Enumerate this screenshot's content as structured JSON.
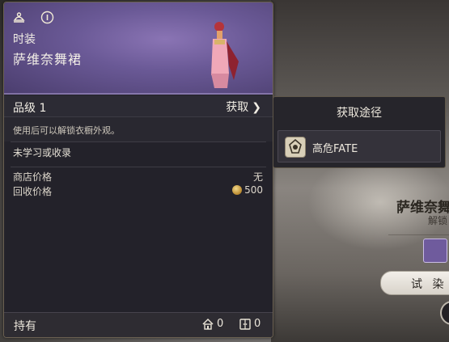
{
  "item": {
    "type": "时装",
    "name": "萨维奈舞裙",
    "grade_label": "品级 1",
    "obtain_label": "获取",
    "description": "使用后可以解锁衣橱外观。",
    "learn_status": "未学习或收录",
    "shop_price_label": "商店价格",
    "shop_price_value": "无",
    "sell_price_label": "回收价格",
    "sell_price_value": "500",
    "hold_label": "持有",
    "house_count": "0",
    "armoire_count": "0"
  },
  "acquisition": {
    "title": "获取途径",
    "entries": [
      "高危FATE"
    ]
  },
  "side": {
    "name": "萨维奈舞",
    "unlock": "解锁",
    "try_on_label": "试 染"
  },
  "icons": {
    "header_left": "wardrobe-icon",
    "header_right": "info-icon",
    "obtain_chevron": "chevron-right-icon",
    "coin": "gil-coin-icon",
    "house": "house-icon",
    "armoire": "armoire-icon",
    "fate": "fate-icon"
  }
}
